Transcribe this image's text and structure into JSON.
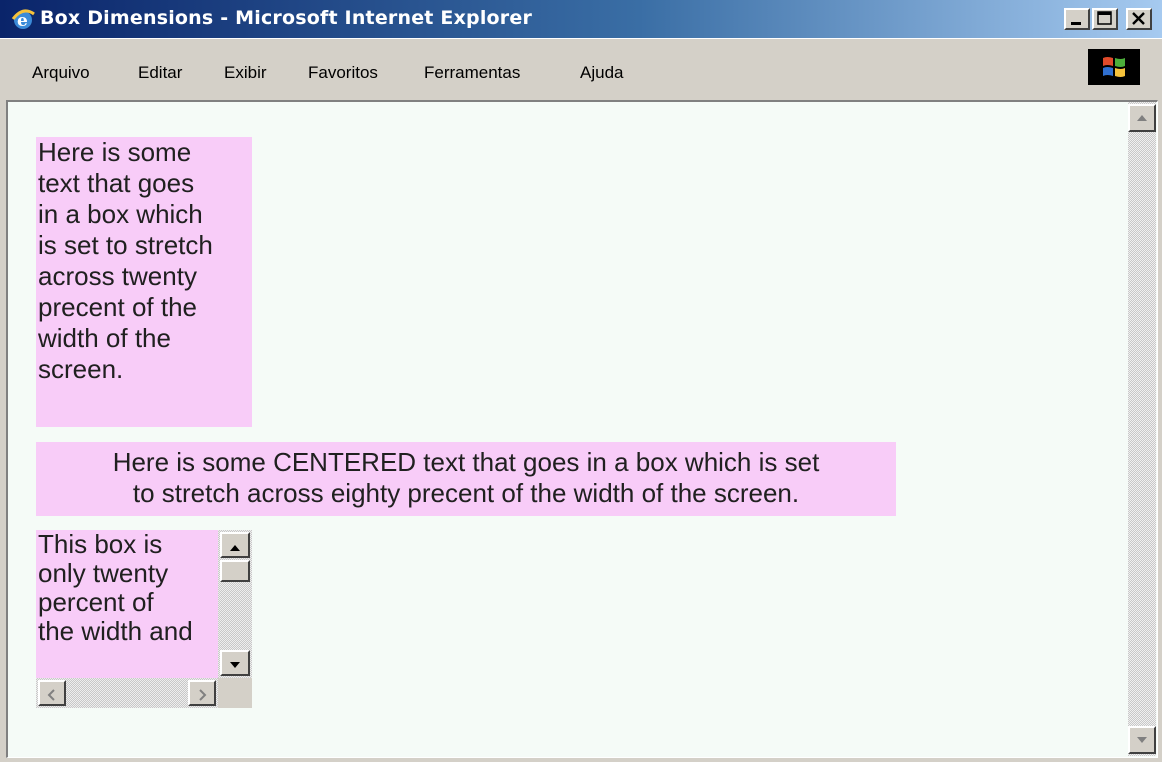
{
  "window": {
    "title": "Box Dimensions - Microsoft Internet Explorer",
    "icon": "ie-icon",
    "buttons": [
      "minimize-icon",
      "maximize-icon",
      "close-icon"
    ]
  },
  "menu": {
    "items": [
      "Arquivo",
      "Editar",
      "Exibir",
      "Favoritos",
      "Ferramentas",
      "Ajuda"
    ],
    "logo": "windows-logo-icon"
  },
  "content": {
    "box_twenty": [
      "Here is some",
      "text that goes",
      "in a box which",
      "is set to stretch",
      "across twenty",
      "precent of the",
      "width of the",
      "screen."
    ],
    "box_eighty": [
      "Here is some CENTERED text that goes in a box which is set",
      "to stretch across eighty precent of the width of the screen."
    ],
    "box_scroll": [
      "This box is",
      "only twenty",
      "percent of",
      "the width and"
    ]
  },
  "colors": {
    "box_background": "#f8ccf8",
    "page_background": "#f5fbf7",
    "title_bar": "#0a246a"
  }
}
